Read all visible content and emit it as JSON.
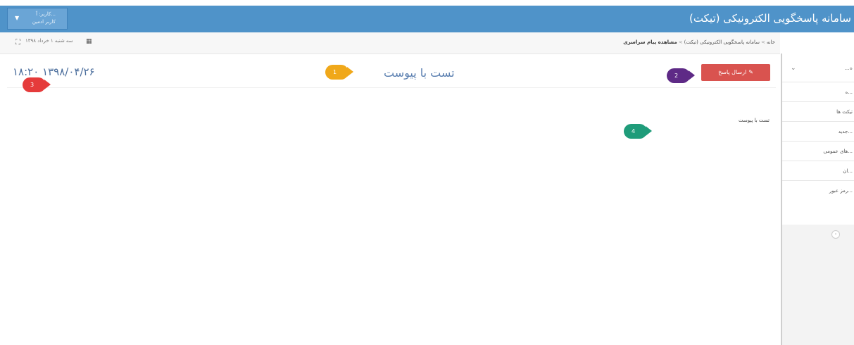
{
  "header": {
    "app_title": "سامانه پاسخگویی الکترونیکی (تیکت)",
    "user_line1": "کاربر: آ...",
    "user_line2": "کاربر ادمین"
  },
  "subbar": {
    "date_label": "سه شنبه ۱ خرداد ۱۳۹۸",
    "breadcrumb": {
      "home": "خانه",
      "section": "سامانه پاسخگویی الکترونیکی (تیکت)",
      "current": "مشاهده پیام سراسری"
    }
  },
  "sidebar": {
    "items": [
      "...ه",
      "...ه",
      "تیکت ها",
      "...جدید",
      "...های عمومی",
      "...ان",
      "...رمز عبور"
    ]
  },
  "message": {
    "title": "تست با پیوست",
    "datetime": "۱۸:۲۰ ۱۳۹۸/۰۴/۲۶",
    "reply_button": "ارسال پاسخ",
    "body": "تست با پیوست"
  },
  "badges": [
    "1",
    "2",
    "3",
    "4"
  ],
  "icons": {
    "expand": "expand-icon",
    "calendar": "calendar-icon",
    "reply": "reply-icon",
    "chevron": "chevron-down-icon"
  },
  "colors": {
    "header": "#4f93c9",
    "reply_button": "#d9534f",
    "badge1": "#f0a81a",
    "badge2": "#5e2a86",
    "badge3": "#e53b3b",
    "badge4": "#1f9c7a"
  }
}
